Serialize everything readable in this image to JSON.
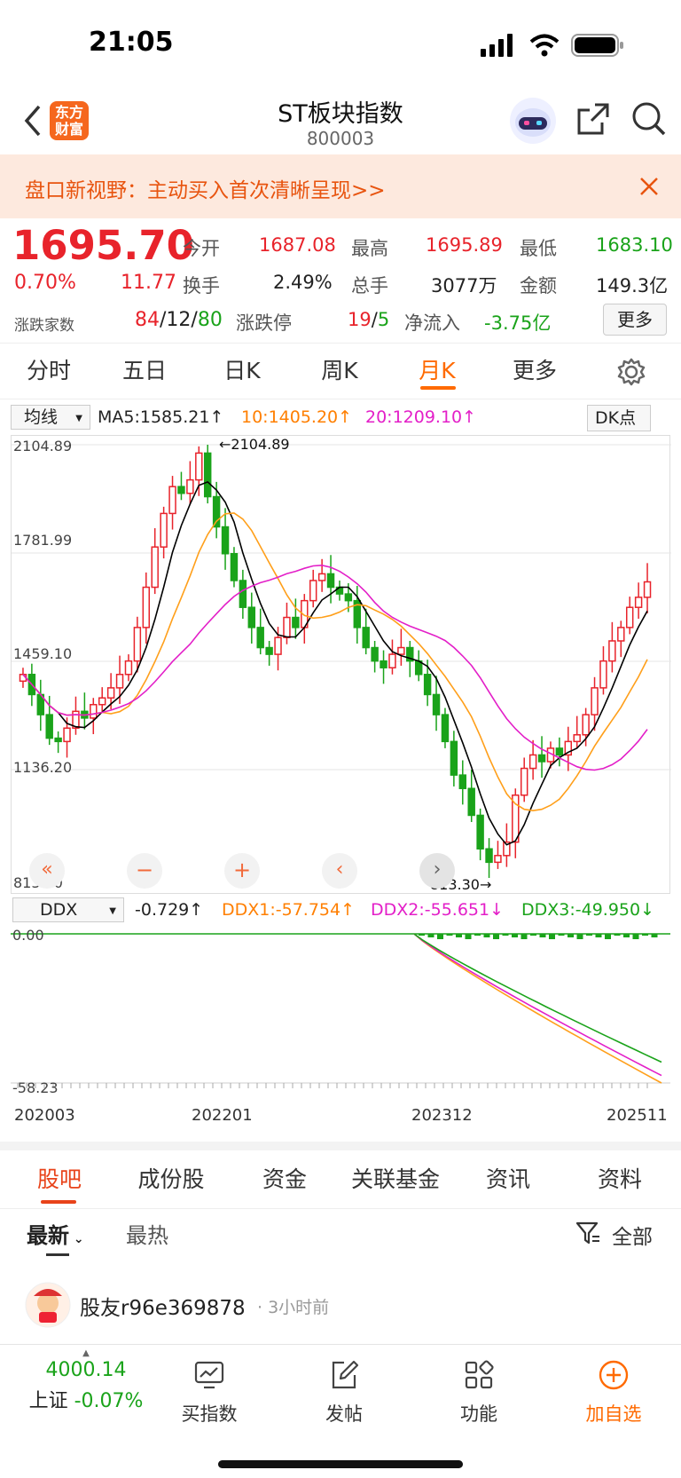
{
  "status": {
    "time": "21:05"
  },
  "header": {
    "logo_text": "东方\n财富",
    "title": "ST板块指数",
    "code": "800003"
  },
  "banner": {
    "text": "盘口新视野：主动买入首次清晰呈现>>"
  },
  "quote": {
    "price": "1695.70",
    "change_pct": "0.70%",
    "change": "11.77",
    "open_label": "今开",
    "open": "1687.08",
    "high_label": "最高",
    "high": "1695.89",
    "low_label": "最低",
    "low": "1683.10",
    "turnover_label": "换手",
    "turnover": "2.49%",
    "volume_label": "总手",
    "volume": "3077万",
    "amount_label": "金额",
    "amount": "149.3亿",
    "breadth_label": "涨跌家数",
    "up": "84",
    "flat": "12",
    "down": "80",
    "limit_label": "涨跌停",
    "limit_up": "19",
    "limit_down": "5",
    "inflow_label": "净流入",
    "inflow": "-3.75亿",
    "more_label": "更多"
  },
  "tabs": [
    {
      "label": "分时"
    },
    {
      "label": "五日"
    },
    {
      "label": "日K"
    },
    {
      "label": "周K"
    },
    {
      "label": "月K",
      "active": true
    },
    {
      "label": "更多"
    }
  ],
  "ma": {
    "selector": "均线",
    "ma5": "MA5:1585.21↑",
    "ma10": "10:1405.20↑",
    "ma20": "20:1209.10↑",
    "dk": "DK点"
  },
  "chart_data": {
    "type": "candlestick",
    "y_ticks": [
      "2104.89",
      "1781.99",
      "1459.10",
      "1136.20",
      "813.30"
    ],
    "high_mark": "←2104.89",
    "low_mark": "813.30→",
    "x_labels": [
      "202003",
      "202201",
      "202312",
      "202511"
    ],
    "ylim": [
      813.3,
      2104.89
    ],
    "ddx": {
      "selector": "DDX",
      "value": "-0.729↑",
      "ddx1": "DDX1:-57.754↑",
      "ddx2": "DDX2:-55.651↓",
      "ddx3": "DDX3:-49.950↓",
      "y_ticks": [
        "0.00",
        "-58.23"
      ],
      "ylim": [
        -58.23,
        0
      ]
    }
  },
  "colors": {
    "up": "#e8232b",
    "down": "#1aa31a",
    "accent": "#ff6a00",
    "ma5": "#000000",
    "ma10": "#ff9f1a",
    "ma20": "#e31fc8"
  },
  "tabs2": [
    {
      "label": "股吧",
      "active": true
    },
    {
      "label": "成份股"
    },
    {
      "label": "资金"
    },
    {
      "label": "关联基金"
    },
    {
      "label": "资讯"
    },
    {
      "label": "资料"
    }
  ],
  "filter": {
    "newest": "最新",
    "hottest": "最热",
    "all": "全部"
  },
  "post": {
    "user": "股友r96e369878",
    "time": "3小时前"
  },
  "bottom": {
    "index_value": "4000.14",
    "index_name": "上证",
    "index_change": "-0.07%",
    "buy_index": "买指数",
    "post": "发帖",
    "func": "功能",
    "add": "加自选"
  }
}
